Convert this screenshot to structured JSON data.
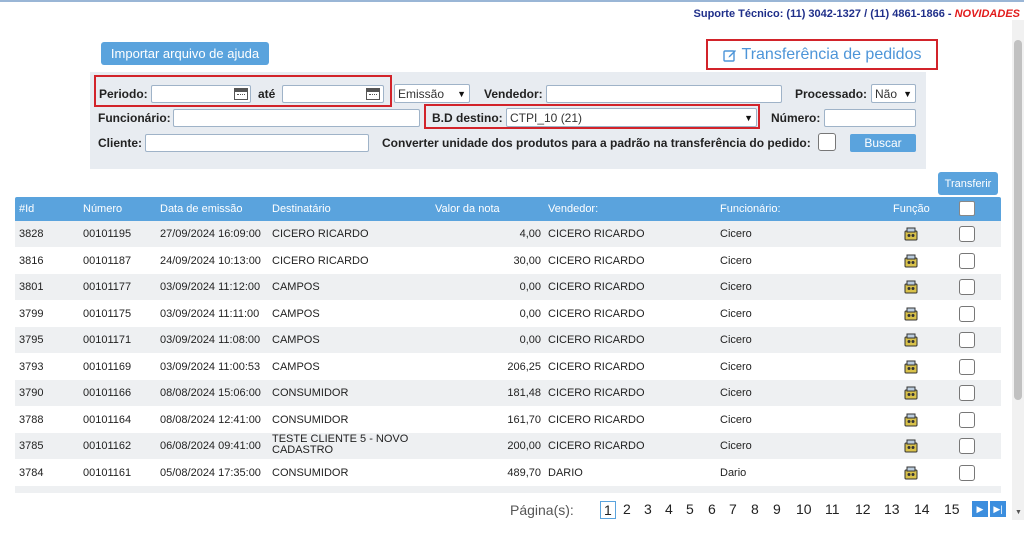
{
  "support": {
    "prefix": "Suporte Técnico: (11) 3042-1327 / (11) 4861-1866 - ",
    "novidades": "NOVIDADES"
  },
  "help_button": "Importar arquivo de ajuda",
  "page_title": "Transferência de pedidos",
  "filters": {
    "periodo_label": "Periodo:",
    "ate_label": "até",
    "date_type_value": "Emissão",
    "vendedor_label": "Vendedor:",
    "processado_label": "Processado:",
    "processado_value": "Não",
    "funcionario_label": "Funcionário:",
    "bd_destino_label": "B.D destino:",
    "bd_destino_value": "CTPI_10 (21)",
    "numero_label": "Número:",
    "cliente_label": "Cliente:",
    "converter_label": "Converter unidade dos produtos para a padrão na transferência do pedido:",
    "search_button": "Buscar"
  },
  "transferir_button": "Transferir",
  "table": {
    "headers": {
      "id": "#Id",
      "numero": "Número",
      "data": "Data de emissão",
      "destinatario": "Destinatário",
      "valor": "Valor da nota",
      "vendedor": "Vendedor:",
      "funcionario": "Funcionário:",
      "funcao": "Função"
    },
    "rows": [
      {
        "id": "3828",
        "numero": "00101195",
        "data": "27/09/2024 16:09:00",
        "destinatario": "CICERO RICARDO",
        "valor": "4,00",
        "vendedor": "CICERO RICARDO",
        "funcionario": "Cicero"
      },
      {
        "id": "3816",
        "numero": "00101187",
        "data": "24/09/2024 10:13:00",
        "destinatario": "CICERO RICARDO",
        "valor": "30,00",
        "vendedor": "CICERO RICARDO",
        "funcionario": "Cicero"
      },
      {
        "id": "3801",
        "numero": "00101177",
        "data": "03/09/2024 11:12:00",
        "destinatario": "CAMPOS",
        "valor": "0,00",
        "vendedor": "CICERO RICARDO",
        "funcionario": "Cicero"
      },
      {
        "id": "3799",
        "numero": "00101175",
        "data": "03/09/2024 11:11:00",
        "destinatario": "CAMPOS",
        "valor": "0,00",
        "vendedor": "CICERO RICARDO",
        "funcionario": "Cicero"
      },
      {
        "id": "3795",
        "numero": "00101171",
        "data": "03/09/2024 11:08:00",
        "destinatario": "CAMPOS",
        "valor": "0,00",
        "vendedor": "CICERO RICARDO",
        "funcionario": "Cicero"
      },
      {
        "id": "3793",
        "numero": "00101169",
        "data": "03/09/2024 11:00:53",
        "destinatario": "CAMPOS",
        "valor": "206,25",
        "vendedor": "CICERO RICARDO",
        "funcionario": "Cicero"
      },
      {
        "id": "3790",
        "numero": "00101166",
        "data": "08/08/2024 15:06:00",
        "destinatario": "CONSUMIDOR",
        "valor": "181,48",
        "vendedor": "CICERO RICARDO",
        "funcionario": "Cicero"
      },
      {
        "id": "3788",
        "numero": "00101164",
        "data": "08/08/2024 12:41:00",
        "destinatario": "CONSUMIDOR",
        "valor": "161,70",
        "vendedor": "CICERO RICARDO",
        "funcionario": "Cicero"
      },
      {
        "id": "3785",
        "numero": "00101162",
        "data": "06/08/2024 09:41:00",
        "destinatario": "TESTE CLIENTE 5 - NOVO CADASTRO",
        "valor": "200,00",
        "vendedor": "CICERO RICARDO",
        "funcionario": "Cicero"
      },
      {
        "id": "3784",
        "numero": "00101161",
        "data": "05/08/2024 17:35:00",
        "destinatario": "CONSUMIDOR",
        "valor": "489,70",
        "vendedor": "DARIO",
        "funcionario": "Dario"
      }
    ]
  },
  "pagination": {
    "label": "Página(s):",
    "pages": [
      "1",
      "2",
      "3",
      "4",
      "5",
      "6",
      "7",
      "8",
      "9",
      "10",
      "11",
      "12",
      "13",
      "14",
      "15"
    ],
    "current": "1"
  },
  "icons": {
    "calendar": "calendar-icon",
    "edit": "edit-icon",
    "funcao": "transfer-function-icon",
    "next": "next-page-icon",
    "last": "last-page-icon"
  },
  "colors": {
    "accent": "#5aa3dd",
    "highlight": "#d2232a",
    "support_text": "#1f2f8a",
    "novidades": "#e21b1b"
  }
}
